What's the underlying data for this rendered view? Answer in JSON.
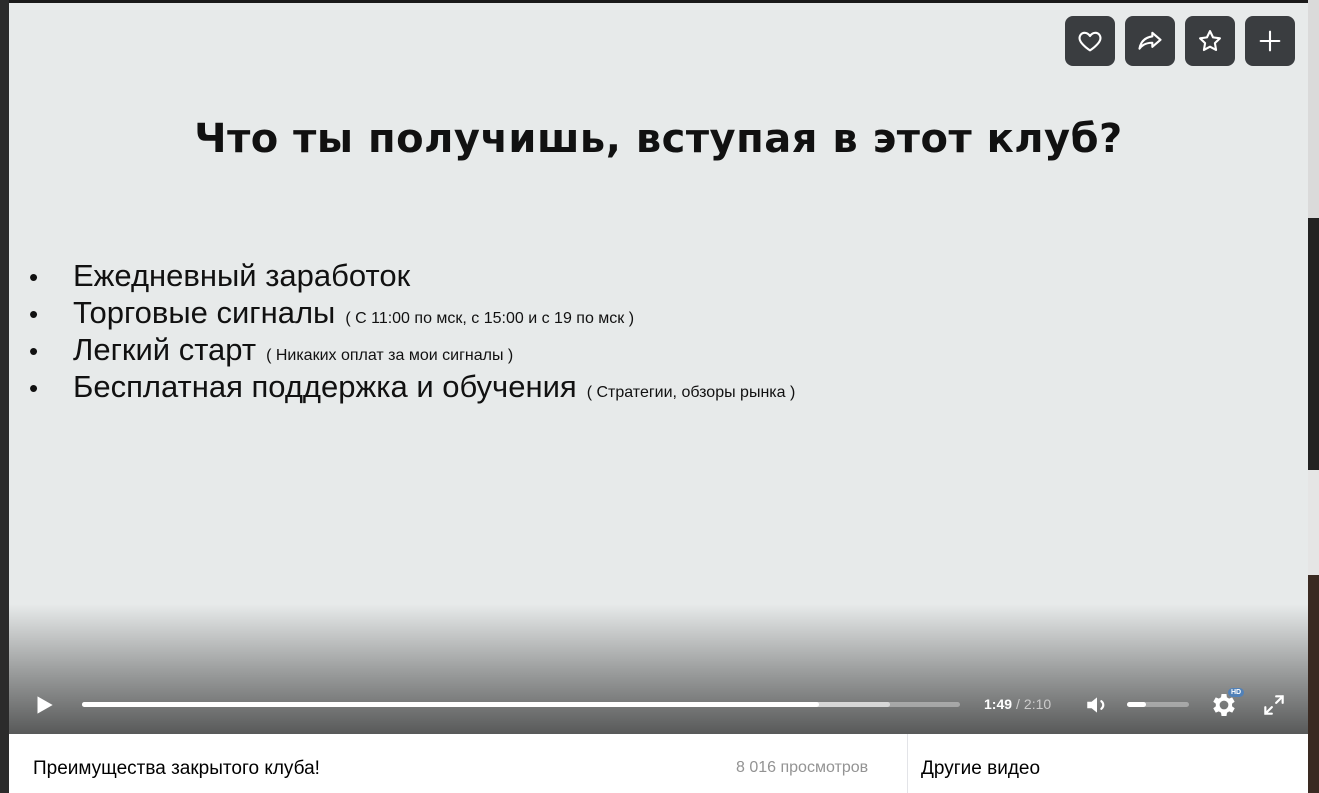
{
  "slide": {
    "title": "Что ты получишь, вступая в этот клуб?",
    "bullets": [
      {
        "main": "Ежедневный заработок",
        "note": ""
      },
      {
        "main": "Торговые сигналы",
        "note": "( С 11:00 по мск, с 15:00 и с 19 по мск )"
      },
      {
        "main": "Легкий старт",
        "note": "( Никаких оплат за мои сигналы )"
      },
      {
        "main": "Бесплатная поддержка и обучения",
        "note": "( Стратегии, обзоры рынка )"
      }
    ],
    "bullet_char": "•"
  },
  "actions": [
    {
      "name": "like",
      "icon": "heart-icon"
    },
    {
      "name": "share",
      "icon": "share-arrow-icon"
    },
    {
      "name": "favorite",
      "icon": "star-icon"
    },
    {
      "name": "add",
      "icon": "plus-icon"
    }
  ],
  "player": {
    "current_time": "1:49",
    "separator": "/",
    "duration": "2:10",
    "played_fraction": 0.839,
    "buffered_fraction": 0.92,
    "volume_fraction": 0.3,
    "quality_badge": "HD"
  },
  "info": {
    "title": "Преимущества закрытого клуба!",
    "views": "8 016 просмотров",
    "other_videos": "Другие видео"
  }
}
